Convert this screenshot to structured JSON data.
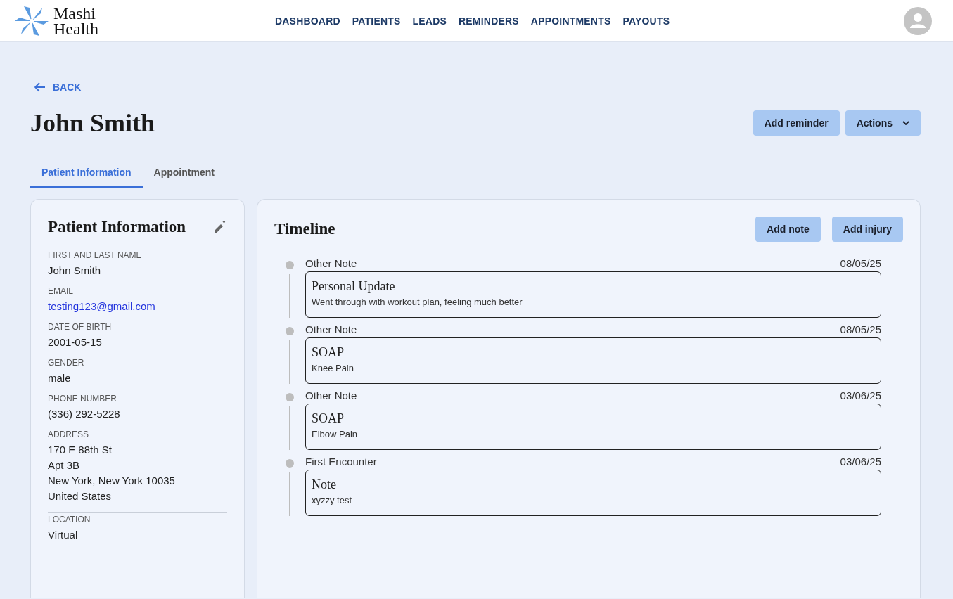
{
  "header": {
    "logo_text": "Mashi\nHealth",
    "nav": [
      "DASHBOARD",
      "PATIENTS",
      "LEADS",
      "REMINDERS",
      "APPOINTMENTS",
      "PAYOUTS"
    ]
  },
  "back": "BACK",
  "title": "John Smith",
  "actions": [
    {
      "label": "Add reminder",
      "kind": "plain"
    },
    {
      "label": "Actions",
      "kind": "menu"
    }
  ],
  "tabs": [
    {
      "label": "Patient Information",
      "selected": true
    },
    {
      "label": "Appointment",
      "selected": false
    }
  ],
  "info": {
    "title": "Patient Information",
    "fields": [
      {
        "label": "FIRST AND LAST NAME",
        "value": "John Smith",
        "kind": "text"
      },
      {
        "label": "EMAIL",
        "value": "testing123@gmail.com",
        "kind": "link"
      },
      {
        "label": "DATE OF BIRTH",
        "value": "2001-05-15",
        "kind": "text"
      },
      {
        "label": "GENDER",
        "value": "male",
        "kind": "text"
      },
      {
        "label": "PHONE NUMBER",
        "value": "(336) 292-5228",
        "kind": "text"
      },
      {
        "label": "ADDRESS",
        "value": "170 E 88th St\nApt 3B\nNew York, New York 10035\nUnited States",
        "kind": "text"
      },
      {
        "label": "LOCATION",
        "value": "Virtual",
        "kind": "text"
      }
    ]
  },
  "timeline": {
    "title": "Timeline",
    "buttons": [
      "Add note",
      "Add injury"
    ],
    "entries": [
      {
        "category": "Other Note",
        "date": "08/05/25",
        "title": "Personal Update",
        "text": "Went through with workout plan, feeling much better"
      },
      {
        "category": "Other Note",
        "date": "08/05/25",
        "title": "SOAP",
        "text": "Knee Pain"
      },
      {
        "category": "Other Note",
        "date": "03/06/25",
        "title": "SOAP",
        "text": "Elbow Pain"
      },
      {
        "category": "First Encounter",
        "date": "03/06/25",
        "title": "Note",
        "text": "xyzzy test"
      }
    ]
  }
}
